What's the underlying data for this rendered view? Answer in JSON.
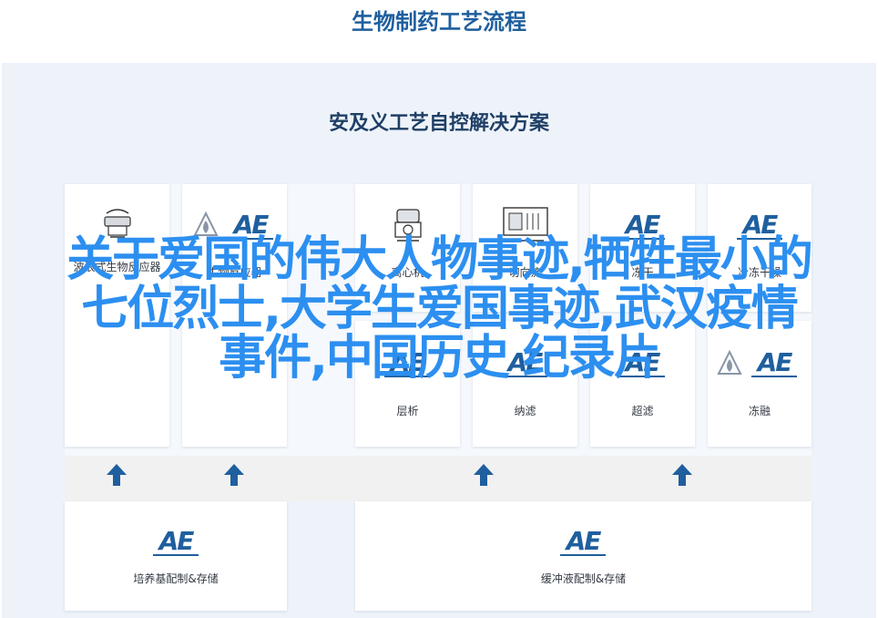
{
  "header": {
    "title": "生物制药工艺流程"
  },
  "diagram": {
    "subtitle": "安及义工艺自控解决方案",
    "top_cards": [
      {
        "label": "波浪式生物反应器",
        "icon": "wave-bioreactor-icon"
      },
      {
        "label": "生物反应器",
        "icon": "ae-logo-icon"
      },
      {
        "label": "离心机",
        "icon": "centrifuge-icon"
      },
      {
        "label": "切向流",
        "icon": "filter-machine-icon"
      },
      {
        "label": "冻干",
        "icon": "ae-logo-icon"
      },
      {
        "label": "冷冻干燥",
        "icon": "ae-logo-icon"
      }
    ],
    "mid_cards": [
      {
        "label": "层析",
        "icon": "ae-logo-icon"
      },
      {
        "label": "纳滤",
        "icon": "ae-logo-icon"
      },
      {
        "label": "超滤",
        "icon": "ae-logo-icon"
      },
      {
        "label": "冻融",
        "icon": "ae-logo-icon"
      }
    ],
    "bottom_cards": [
      {
        "label": "培养基配制&存储",
        "icon": "ae-logo-icon"
      },
      {
        "label": "缓冲液配制&存储",
        "icon": "ae-logo-icon"
      }
    ],
    "logo_text": "AE",
    "colors": {
      "brand": "#1f5f9e",
      "panel": "#eef3fa",
      "overlay": "#2c8ff0"
    }
  },
  "overlay": {
    "lines": [
      "关于爱国的伟大人物事迹,牺牲最小的",
      "七位烈士,大学生爱国事迹,武汉疫情",
      "事件,中国历史 纪录片"
    ]
  }
}
